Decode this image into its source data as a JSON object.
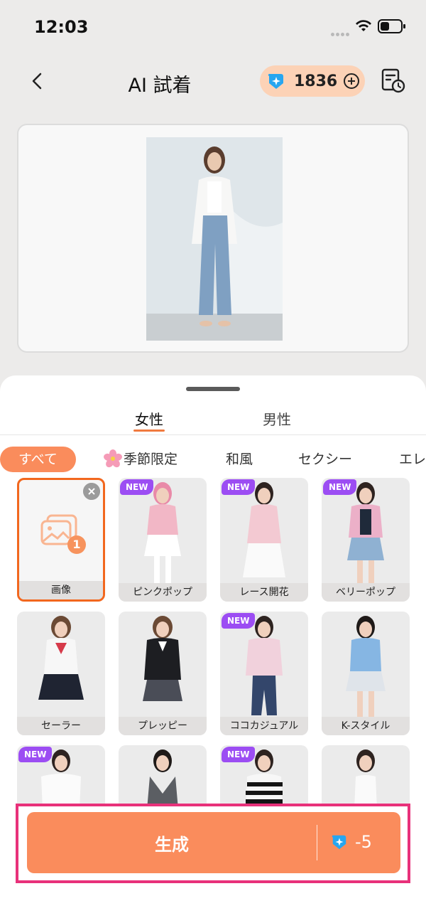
{
  "status_bar": {
    "time": "12:03"
  },
  "header": {
    "title": "AI 試着",
    "credits": "1836"
  },
  "colors": {
    "accent": "#fa8c5c",
    "new_badge": "#9c4df3",
    "highlight_frame": "#e8317a",
    "selected_border": "#f2671e"
  },
  "gender_tabs": [
    {
      "label": "女性",
      "active": true
    },
    {
      "label": "男性",
      "active": false
    }
  ],
  "categories": [
    {
      "label": "すべて",
      "active": true
    },
    {
      "label": "季節限定",
      "icon": "flower-icon"
    },
    {
      "label": "和風"
    },
    {
      "label": "セクシー"
    },
    {
      "label": "エレ"
    }
  ],
  "styles": [
    {
      "label": "画像",
      "selected": true,
      "count": "1"
    },
    {
      "label": "ピンクポップ",
      "badge": "NEW"
    },
    {
      "label": "レース開花",
      "badge": "NEW"
    },
    {
      "label": "ベリーポップ",
      "badge": "NEW"
    },
    {
      "label": "セーラー"
    },
    {
      "label": "プレッピー"
    },
    {
      "label": "ココカジュアル",
      "badge": "NEW"
    },
    {
      "label": "K-スタイル"
    },
    {
      "label": "",
      "badge": "NEW"
    },
    {
      "label": ""
    },
    {
      "label": "",
      "badge": "NEW"
    },
    {
      "label": ""
    }
  ],
  "generate": {
    "label": "生成",
    "cost": "-5"
  }
}
